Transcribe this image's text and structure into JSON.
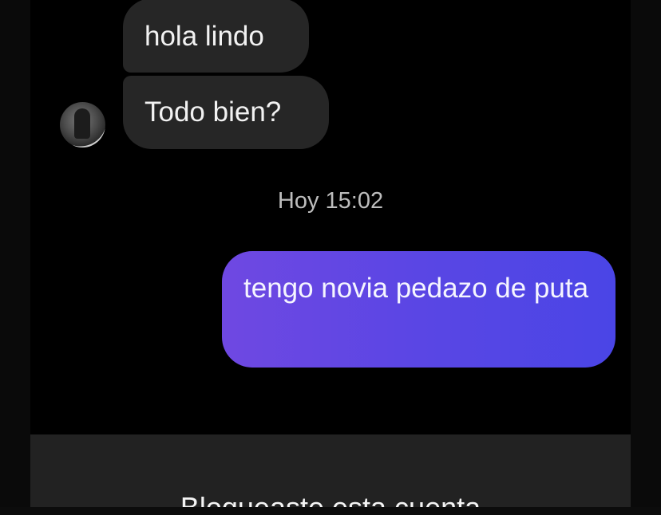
{
  "conversation": {
    "messages": [
      {
        "direction": "incoming",
        "text": "hola lindo"
      },
      {
        "direction": "incoming",
        "text": "Todo bien?"
      },
      {
        "direction": "outgoing",
        "text": "tengo novia pedazo de puta"
      }
    ],
    "timestamp": "Hoy 15:02"
  },
  "blocked_notice": {
    "text": "Bloqueaste esta cuenta"
  },
  "colors": {
    "background": "#000000",
    "incoming_bubble": "#262626",
    "outgoing_bubble_start": "#6f48e2",
    "outgoing_bubble_end": "#4a45e6",
    "blocked_bar": "#222222"
  },
  "icons": {
    "avatar": "profile-avatar"
  }
}
